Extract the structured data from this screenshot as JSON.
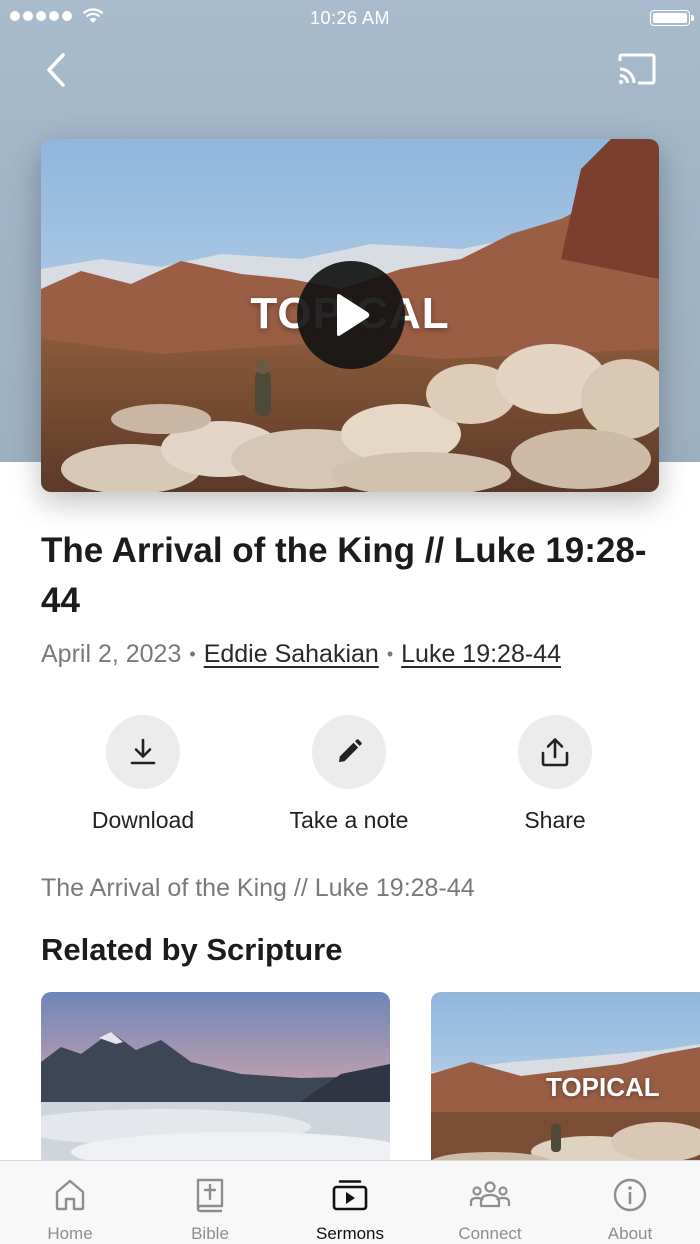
{
  "status_bar": {
    "time": "10:26 AM"
  },
  "video": {
    "thumbnail_label": "TOPICAL"
  },
  "sermon": {
    "title": "The Arrival of the King // Luke 19:28-44",
    "date": "April 2, 2023",
    "speaker": "Eddie Sahakian",
    "scripture": "Luke 19:28-44",
    "description": "The Arrival of the King // Luke 19:28-44"
  },
  "actions": [
    {
      "label": "Download",
      "icon": "download-icon"
    },
    {
      "label": "Take a note",
      "icon": "pencil-icon"
    },
    {
      "label": "Share",
      "icon": "share-icon"
    }
  ],
  "related": {
    "title": "Related by Scripture",
    "cards": [
      {
        "thumbnail_label": ""
      },
      {
        "thumbnail_label": "TOPICAL"
      }
    ]
  },
  "tabs": [
    {
      "label": "Home",
      "icon": "home-icon",
      "active": false
    },
    {
      "label": "Bible",
      "icon": "bible-icon",
      "active": false
    },
    {
      "label": "Sermons",
      "icon": "sermons-icon",
      "active": true
    },
    {
      "label": "Connect",
      "icon": "people-icon",
      "active": false
    },
    {
      "label": "About",
      "icon": "info-icon",
      "active": false
    }
  ],
  "colors": {
    "header_bg": "#a8bccd",
    "action_circle": "#ececec",
    "tab_active": "#111111",
    "tab_inactive": "#8e8e8e"
  }
}
